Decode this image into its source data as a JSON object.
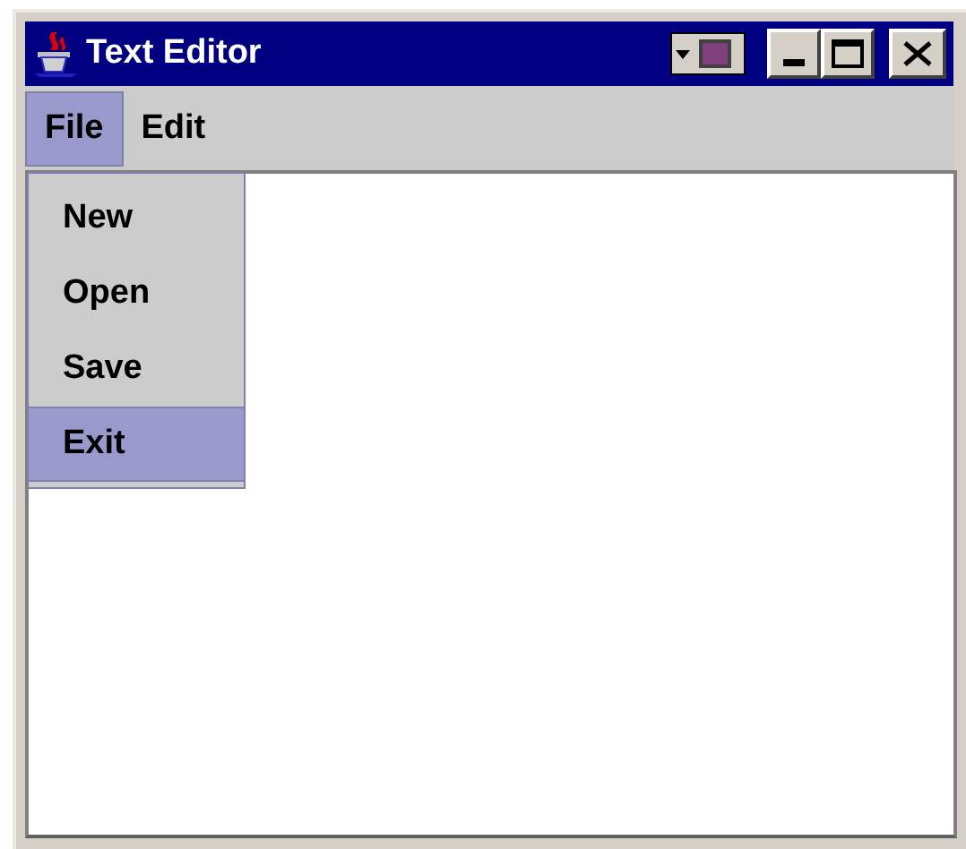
{
  "window": {
    "title": "Text Editor"
  },
  "menu": [
    {
      "label": "File",
      "selected": true
    },
    {
      "label": "Edit",
      "selected": false
    }
  ],
  "dropdown": [
    {
      "label": "New",
      "selected": false
    },
    {
      "label": "Open",
      "selected": false
    },
    {
      "label": "Save",
      "selected": false
    },
    {
      "label": "Exit",
      "selected": true
    }
  ]
}
